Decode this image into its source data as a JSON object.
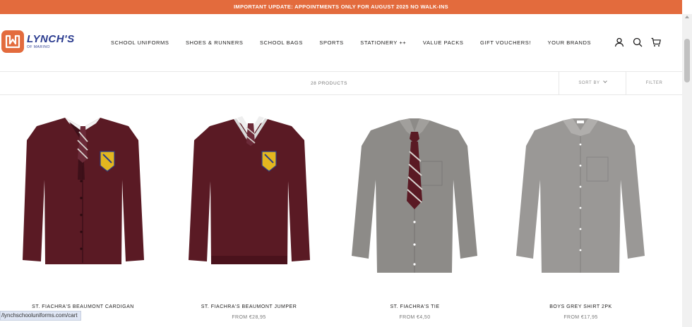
{
  "announcement": {
    "text": "IMPORTANT UPDATE: APPOINTMENTS ONLY FOR AUGUST 2025 NO WALK-INS"
  },
  "logo": {
    "name": "LYNCH'S",
    "sub": "OF MARINO",
    "brand_color": "#e36b3d",
    "text_color": "#2a3b8f"
  },
  "nav": {
    "items": [
      "SCHOOL UNIFORMS",
      "SHOES & RUNNERS",
      "SCHOOL BAGS",
      "SPORTS",
      "STATIONERY ++",
      "VALUE PACKS",
      "GIFT VOUCHERS!",
      "YOUR BRANDS"
    ]
  },
  "header_icons": [
    "account-icon",
    "search-icon",
    "cart-icon"
  ],
  "toolbar": {
    "count": "28 PRODUCTS",
    "sort_label": "SORT BY",
    "filter_label": "FILTER"
  },
  "products": [
    {
      "title": "ST. FIACHRA'S BEAUMONT CARDIGAN",
      "price": ""
    },
    {
      "title": "ST. FIACHRA'S BEAUMONT JUMPER",
      "price": "FROM €28,95"
    },
    {
      "title": "ST. FIACHRA'S TIE",
      "price": "FROM €4,50"
    },
    {
      "title": "BOYS GREY SHIRT 2PK",
      "price": "FROM €17,95"
    }
  ],
  "status_bar": {
    "url": "/lynchschooluniforms.com/cart"
  },
  "colors": {
    "accent": "#e36b3d",
    "maroon": "#5a1a24",
    "grey_shirt": "#8d8b88"
  }
}
